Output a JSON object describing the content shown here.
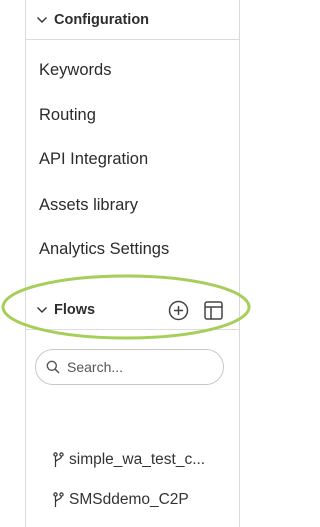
{
  "configuration": {
    "title": "Configuration",
    "items": [
      {
        "label": "Keywords"
      },
      {
        "label": "Routing"
      },
      {
        "label": "API Integration"
      },
      {
        "label": "Assets library"
      },
      {
        "label": "Analytics Settings"
      }
    ]
  },
  "flows": {
    "title": "Flows",
    "search": {
      "placeholder": "Search..."
    },
    "items": [
      {
        "label": "simple_wa_test_c..."
      },
      {
        "label": "SMSddemo_C2P"
      }
    ]
  },
  "colors": {
    "highlight": "#a6cf5a",
    "border": "#d9d9d9",
    "text": "#2b2b2b"
  }
}
